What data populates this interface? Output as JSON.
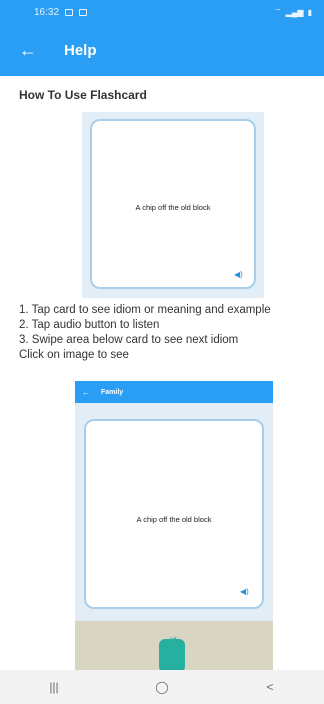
{
  "status_bar": {
    "time": "16:32",
    "icons": [
      "gallery-icon",
      "message-icon",
      "wifi-icon",
      "signal-icon",
      "battery-icon"
    ]
  },
  "app_bar": {
    "back_icon": "arrow-left-icon",
    "title": "Help",
    "color": "#2a9df4"
  },
  "content": {
    "heading": "How To Use Flashcard",
    "preview_card": {
      "text": "A chip off the old block",
      "audio_icon": "speaker-icon"
    },
    "instructions": [
      "1. Tap card to see idiom or meaning and example",
      "2. Tap audio button to listen",
      "3. Swipe area below card to see next idiom",
      "Click on image to see"
    ],
    "preview_screen": {
      "title": "Family",
      "card_text": "A chip off the old block",
      "audio_icon": "speaker-icon",
      "swipe_icon": "swipe-hand-icon"
    }
  },
  "nav_bar": {
    "recent_icon": "recent-apps-icon",
    "home_icon": "home-icon",
    "back_icon": "back-icon"
  }
}
